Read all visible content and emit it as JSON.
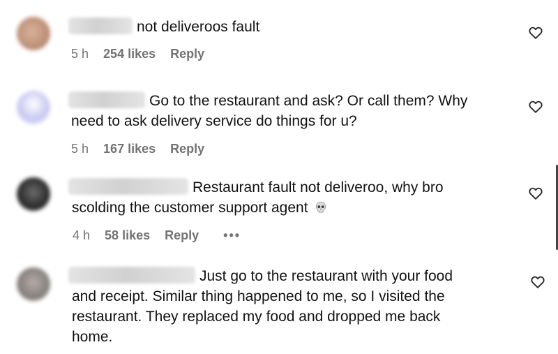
{
  "comments": [
    {
      "text_lines": [
        "not deliveroos fault"
      ],
      "time": "5 h",
      "likes": "254 likes",
      "reply": "Reply",
      "avatar_color": "#c79a82"
    },
    {
      "text_lines": [
        "Go to the restaurant and ask? Or call them? Why",
        "need to ask delivery service do things for u?"
      ],
      "time": "5 h",
      "likes": "167 likes",
      "reply": "Reply",
      "avatar_color": "#c5c5f0"
    },
    {
      "text_lines": [
        "Restaurant fault not deliveroo, why bro",
        "scolding the customer support agent"
      ],
      "emoji": "skull-emoji",
      "time": "4 h",
      "likes": "58 likes",
      "reply": "Reply",
      "more": "•••",
      "avatar_color": "#3a3a3a"
    },
    {
      "text_lines": [
        "Just go to the restaurant with your food",
        "and receipt. Similar thing happened to me, so I visited the",
        "restaurant. They replaced my food and dropped me back",
        "home."
      ],
      "avatar_color": "#8f8a86"
    }
  ],
  "icons": {
    "like": "heart-outline-icon"
  }
}
